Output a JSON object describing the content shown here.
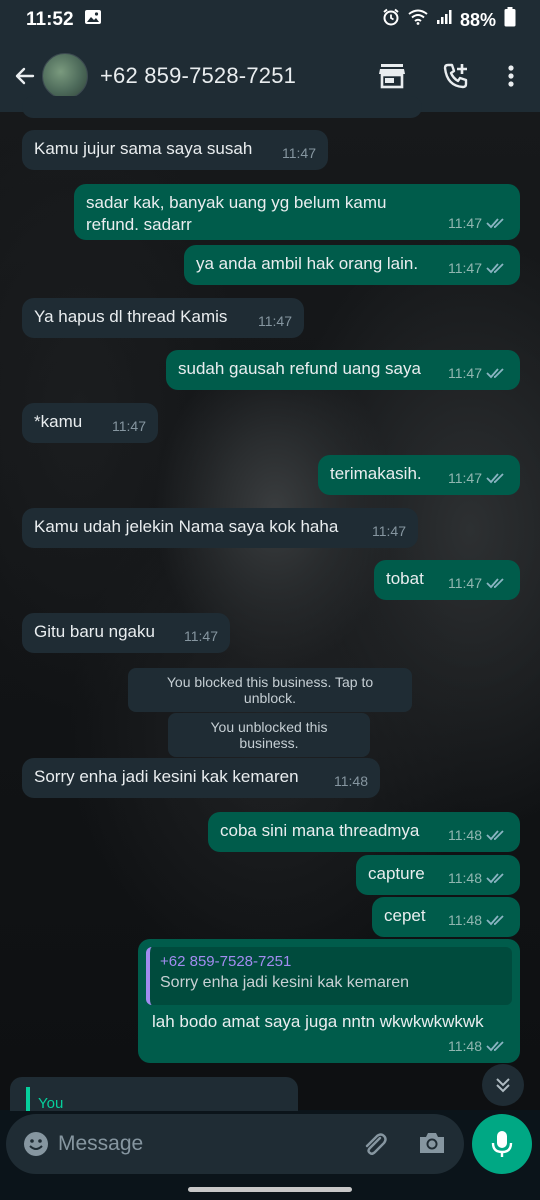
{
  "status_bar": {
    "time": "11:52",
    "battery": "88%",
    "icons": [
      "gallery-icon",
      "alarm-icon",
      "wifi-icon",
      "signal-icon",
      "battery-icon"
    ]
  },
  "header": {
    "contact": "+62 859-7528-7251",
    "icons": [
      "back-arrow-icon",
      "store-icon",
      "add-call-icon",
      "more-vert-icon"
    ]
  },
  "messages": [
    {
      "dir": "in",
      "text": "Kamu jujur sama saya susah",
      "time": "11:47"
    },
    {
      "dir": "out",
      "text": "sadar kak, banyak uang yg belum kamu refund. sadarr",
      "time": "11:47",
      "read": true
    },
    {
      "dir": "out",
      "text": "ya anda ambil hak orang lain.",
      "time": "11:47",
      "read": true
    },
    {
      "dir": "in",
      "text": "Ya hapus dl thread Kamis",
      "time": "11:47"
    },
    {
      "dir": "out",
      "text": "sudah gausah refund uang saya",
      "time": "11:47",
      "read": true
    },
    {
      "dir": "in",
      "text": "*kamu",
      "time": "11:47"
    },
    {
      "dir": "out",
      "text": "terimakasih.",
      "time": "11:47",
      "read": true
    },
    {
      "dir": "in",
      "text": "Kamu udah jelekin Nama saya kok haha",
      "time": "11:47"
    },
    {
      "dir": "out",
      "text": "tobat",
      "time": "11:47",
      "read": true
    },
    {
      "dir": "in",
      "text": "Gitu baru ngaku",
      "time": "11:47"
    },
    {
      "dir": "system",
      "text": "You blocked this business. Tap to unblock."
    },
    {
      "dir": "system",
      "text": "You unblocked this business."
    },
    {
      "dir": "in",
      "text": "Sorry enha jadi kesini kak kemaren",
      "time": "11:48"
    },
    {
      "dir": "out",
      "text": "coba sini mana threadmya",
      "time": "11:48",
      "read": true
    },
    {
      "dir": "out",
      "text": "capture",
      "time": "11:48",
      "read": true
    },
    {
      "dir": "out",
      "text": "cepet",
      "time": "11:48",
      "read": true
    },
    {
      "dir": "out",
      "text": "lah bodo amat saya juga nntn wkwkwkwkwk",
      "time": "11:48",
      "read": true,
      "quote": {
        "author": "+62 859-7528-7251",
        "text": "Sorry enha jadi kesini kak kemaren"
      }
    },
    {
      "dir": "in",
      "partial": true,
      "quote_author": "You"
    }
  ],
  "composer": {
    "placeholder": "Message",
    "icons": [
      "emoji-icon",
      "attach-icon",
      "camera-icon",
      "mic-icon"
    ]
  },
  "colors": {
    "bar": "#1f2c34",
    "incoming": "#1f2c34",
    "outgoing": "#005c4b",
    "accent": "#00a884",
    "read_ticks": "#53bdeb"
  }
}
